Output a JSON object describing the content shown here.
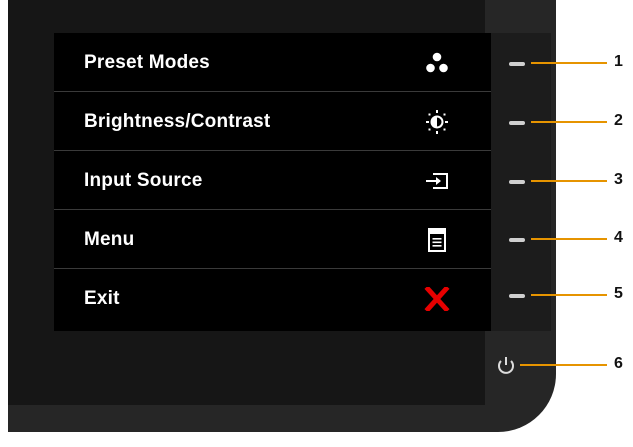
{
  "menu": {
    "items": [
      {
        "label": "Preset Modes",
        "icon": "preset-modes-icon"
      },
      {
        "label": "Brightness/Contrast",
        "icon": "brightness-icon"
      },
      {
        "label": "Input Source",
        "icon": "input-source-icon"
      },
      {
        "label": "Menu",
        "icon": "menu-icon"
      },
      {
        "label": "Exit",
        "icon": "exit-x-icon"
      }
    ]
  },
  "callouts": [
    "1",
    "2",
    "3",
    "4",
    "5",
    "6"
  ],
  "colors": {
    "osd_background": "#000000",
    "bezel": "#262626",
    "callout_line": "#e69400",
    "exit_icon": "#e80000",
    "label_text": "#ffffff"
  }
}
